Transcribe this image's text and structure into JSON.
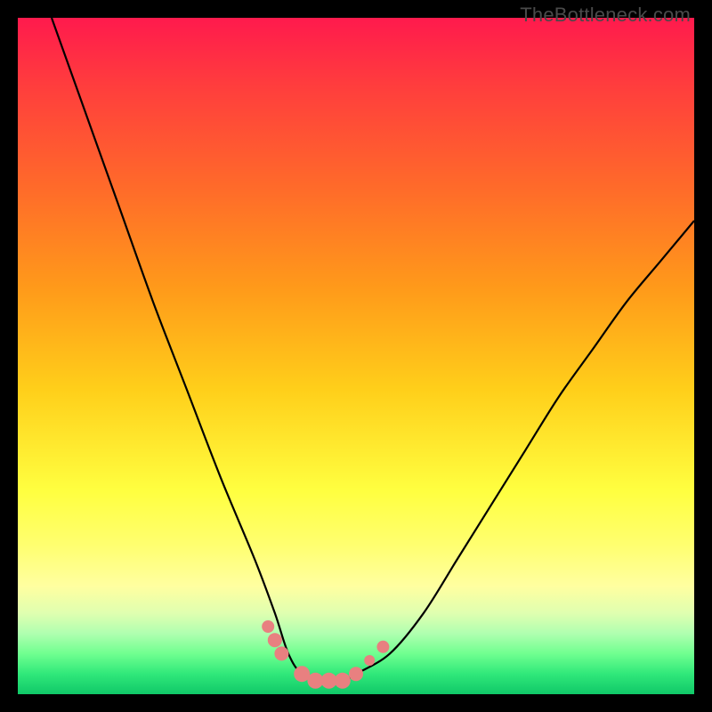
{
  "watermark": "TheBottleneck.com",
  "chart_data": {
    "type": "line",
    "title": "",
    "xlabel": "",
    "ylabel": "",
    "xlim": [
      0,
      100
    ],
    "ylim": [
      0,
      100
    ],
    "grid": false,
    "legend": false,
    "series": [
      {
        "name": "bottleneck-curve",
        "color": "#000000",
        "x": [
          5,
          10,
          15,
          20,
          25,
          30,
          35,
          38,
          40,
          42,
          45,
          48,
          50,
          55,
          60,
          65,
          70,
          75,
          80,
          85,
          90,
          95,
          100
        ],
        "y": [
          100,
          86,
          72,
          58,
          45,
          32,
          20,
          12,
          6,
          3,
          2,
          2,
          3,
          6,
          12,
          20,
          28,
          36,
          44,
          51,
          58,
          64,
          70
        ]
      }
    ],
    "markers": [
      {
        "name": "marker-left-slope-1",
        "x": 37,
        "y": 10,
        "color": "#e88080",
        "size": 8
      },
      {
        "name": "marker-left-slope-2",
        "x": 38,
        "y": 8,
        "color": "#e88080",
        "size": 10
      },
      {
        "name": "marker-left-slope-3",
        "x": 39,
        "y": 6,
        "color": "#e88080",
        "size": 10
      },
      {
        "name": "marker-bottom-1",
        "x": 42,
        "y": 3,
        "color": "#e88080",
        "size": 12
      },
      {
        "name": "marker-bottom-2",
        "x": 44,
        "y": 2,
        "color": "#e88080",
        "size": 12
      },
      {
        "name": "marker-bottom-3",
        "x": 46,
        "y": 2,
        "color": "#e88080",
        "size": 12
      },
      {
        "name": "marker-bottom-4",
        "x": 48,
        "y": 2,
        "color": "#e88080",
        "size": 12
      },
      {
        "name": "marker-right-slope-1",
        "x": 50,
        "y": 3,
        "color": "#e88080",
        "size": 10
      },
      {
        "name": "marker-right-gap",
        "x": 52,
        "y": 5,
        "color": "#e88080",
        "size": 6
      },
      {
        "name": "marker-right-slope-2",
        "x": 54,
        "y": 7,
        "color": "#e88080",
        "size": 8
      }
    ],
    "background_gradient": {
      "top": "#ff1a4d",
      "mid": "#ffff40",
      "bottom": "#10c868"
    }
  }
}
